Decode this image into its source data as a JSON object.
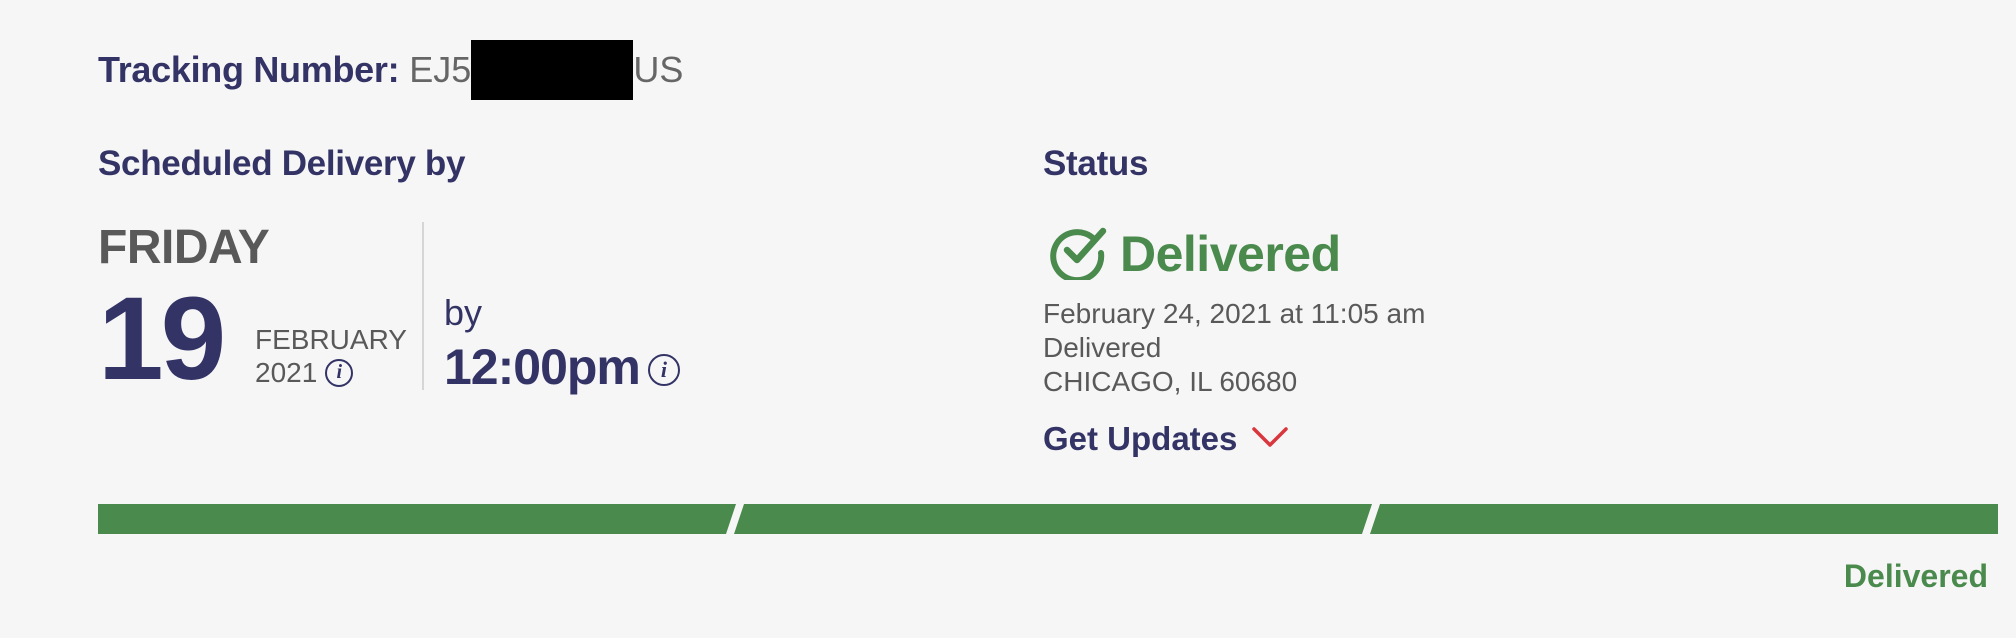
{
  "tracking": {
    "label": "Tracking Number:",
    "number_prefix": "EJ5",
    "number_suffix": "US"
  },
  "scheduled": {
    "heading": "Scheduled Delivery by",
    "day_name": "FRIDAY",
    "day_number": "19",
    "month": "FEBRUARY",
    "year": "2021",
    "by_label": "by",
    "time": "12:00pm",
    "info_icon": "i"
  },
  "status": {
    "heading": "Status",
    "main_text": "Delivered",
    "detail_datetime": "February 24, 2021 at 11:05 am",
    "detail_event": "Delivered",
    "detail_location": "CHICAGO, IL 60680",
    "get_updates_label": "Get Updates"
  },
  "progress": {
    "segments_total": 3,
    "segments_complete": 3,
    "label": "Delivered"
  },
  "colors": {
    "navy": "#333366",
    "green": "#4a8a4c",
    "chevron_red": "#d9363e",
    "background": "#f6f6f6"
  },
  "icons": {
    "status_icon": "check-circle-icon",
    "info_icon": "info-icon",
    "updates_icon": "chevron-down-icon"
  }
}
